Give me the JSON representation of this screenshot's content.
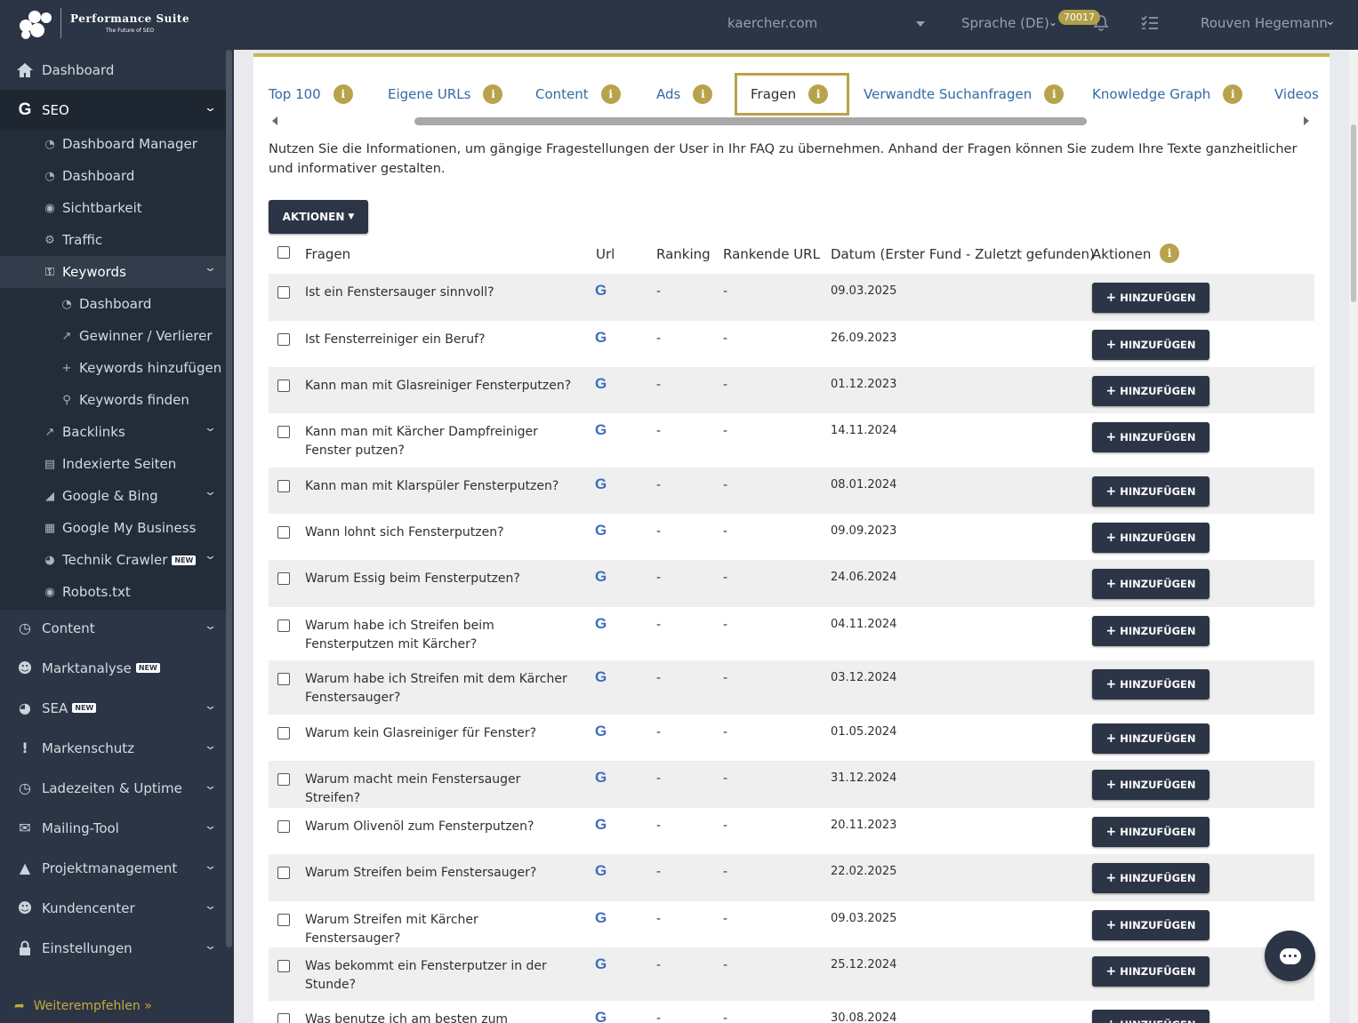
{
  "brand": {
    "title": "Performance Suite",
    "subtitle": "The Future of SEO"
  },
  "topbar": {
    "domain": "kaercher.com",
    "language": "Sprache (DE)",
    "notification_count": "70017",
    "user": "Rouven Hegemann"
  },
  "sidebar": {
    "items": [
      {
        "label": "Dashboard",
        "icon": "home-icon"
      },
      {
        "label": "SEO",
        "icon": "google-g-icon"
      },
      {
        "label": "Dashboard Manager",
        "icon": "dashboard-gauge-icon"
      },
      {
        "label": "Dashboard",
        "icon": "dashboard-gauge-icon"
      },
      {
        "label": "Sichtbarkeit",
        "icon": "eye-icon"
      },
      {
        "label": "Traffic",
        "icon": "cogs-icon"
      },
      {
        "label": "Keywords",
        "icon": "key-icon"
      },
      {
        "label": "Dashboard",
        "icon": "dashboard-gauge-icon"
      },
      {
        "label": "Gewinner / Verlierer",
        "icon": "external-link-icon"
      },
      {
        "label": "Keywords hinzufügen",
        "icon": "plus-icon"
      },
      {
        "label": "Keywords finden",
        "icon": "search-icon"
      },
      {
        "label": "Backlinks",
        "icon": "external-link-icon"
      },
      {
        "label": "Indexierte Seiten",
        "icon": "file-icon"
      },
      {
        "label": "Google & Bing",
        "icon": "area-chart-icon"
      },
      {
        "label": "Google My Business",
        "icon": "store-icon"
      },
      {
        "label": "Technik Crawler",
        "icon": "pie-chart-icon",
        "tag": "NEW"
      },
      {
        "label": "Robots.txt",
        "icon": "eye-icon"
      },
      {
        "label": "Content",
        "icon": "clock-icon"
      },
      {
        "label": "Marktanalyse",
        "icon": "users-icon",
        "tag": "NEW"
      },
      {
        "label": "SEA",
        "icon": "pie-chart-icon",
        "tag": "NEW"
      },
      {
        "label": "Markenschutz",
        "icon": "exclamation-icon"
      },
      {
        "label": "Ladezeiten & Uptime",
        "icon": "clock-icon"
      },
      {
        "label": "Mailing-Tool",
        "icon": "envelope-icon"
      },
      {
        "label": "Projektmanagement",
        "icon": "road-icon"
      },
      {
        "label": "Kundencenter",
        "icon": "users-icon"
      },
      {
        "label": "Einstellungen",
        "icon": "lock-icon"
      }
    ],
    "refer": "Weiterempfehlen »"
  },
  "tabs": [
    {
      "label": "Top 100"
    },
    {
      "label": "Eigene URLs"
    },
    {
      "label": "Content"
    },
    {
      "label": "Ads"
    },
    {
      "label": "Fragen",
      "active": true
    },
    {
      "label": "Verwandte Suchanfragen"
    },
    {
      "label": "Knowledge Graph"
    },
    {
      "label": "Videos"
    }
  ],
  "intro": "Nutzen Sie die Informationen, um gängige Fragestellungen der User in Ihr FAQ zu übernehmen. Anhand der Fragen können Sie zudem Ihre Texte ganzheitlicher und informativer gestalten.",
  "actions_label": "AKTIONEN",
  "table": {
    "headers": [
      "Fragen",
      "Url",
      "Ranking",
      "Rankende URL",
      "Datum (Erster Fund - Zuletzt gefunden)",
      "Aktionen"
    ],
    "add_label": "HINZUFÜGEN",
    "url_icon": "G",
    "rows": [
      {
        "question": "Ist ein Fenstersauger sinnvoll?",
        "ranking": "-",
        "ranking_url": "-",
        "date": "09.03.2025"
      },
      {
        "question": "Ist Fensterreiniger ein Beruf?",
        "ranking": "-",
        "ranking_url": "-",
        "date": "26.09.2023"
      },
      {
        "question": "Kann man mit Glasreiniger Fensterputzen?",
        "ranking": "-",
        "ranking_url": "-",
        "date": "01.12.2023"
      },
      {
        "question": "Kann man mit Kärcher Dampfreiniger Fenster putzen?",
        "ranking": "-",
        "ranking_url": "-",
        "date": "14.11.2024"
      },
      {
        "question": "Kann man mit Klarspüler Fensterputzen?",
        "ranking": "-",
        "ranking_url": "-",
        "date": "08.01.2024"
      },
      {
        "question": "Wann lohnt sich Fensterputzen?",
        "ranking": "-",
        "ranking_url": "-",
        "date": "09.09.2023"
      },
      {
        "question": "Warum Essig beim Fensterputzen?",
        "ranking": "-",
        "ranking_url": "-",
        "date": "24.06.2024"
      },
      {
        "question": "Warum habe ich Streifen beim Fensterputzen mit Kärcher?",
        "ranking": "-",
        "ranking_url": "-",
        "date": "04.11.2024"
      },
      {
        "question": "Warum habe ich Streifen mit dem Kärcher Fenstersauger?",
        "ranking": "-",
        "ranking_url": "-",
        "date": "03.12.2024"
      },
      {
        "question": "Warum kein Glasreiniger für Fenster?",
        "ranking": "-",
        "ranking_url": "-",
        "date": "01.05.2024"
      },
      {
        "question": "Warum macht mein Fenstersauger Streifen?",
        "ranking": "-",
        "ranking_url": "-",
        "date": "31.12.2024"
      },
      {
        "question": "Warum Olivenöl zum Fensterputzen?",
        "ranking": "-",
        "ranking_url": "-",
        "date": "20.11.2023"
      },
      {
        "question": "Warum Streifen beim Fenstersauger?",
        "ranking": "-",
        "ranking_url": "-",
        "date": "22.02.2025"
      },
      {
        "question": "Warum Streifen mit Kärcher Fenstersauger?",
        "ranking": "-",
        "ranking_url": "-",
        "date": "09.03.2025"
      },
      {
        "question": "Was bekommt ein Fensterputzer in der Stunde?",
        "ranking": "-",
        "ranking_url": "-",
        "date": "25.12.2024"
      },
      {
        "question": "Was benutze ich am besten zum",
        "ranking": "-",
        "ranking_url": "-",
        "date": "30.08.2024"
      }
    ]
  },
  "colors": {
    "navy": "#2b3545",
    "gold": "#b8a24c",
    "link": "#3469a4"
  }
}
